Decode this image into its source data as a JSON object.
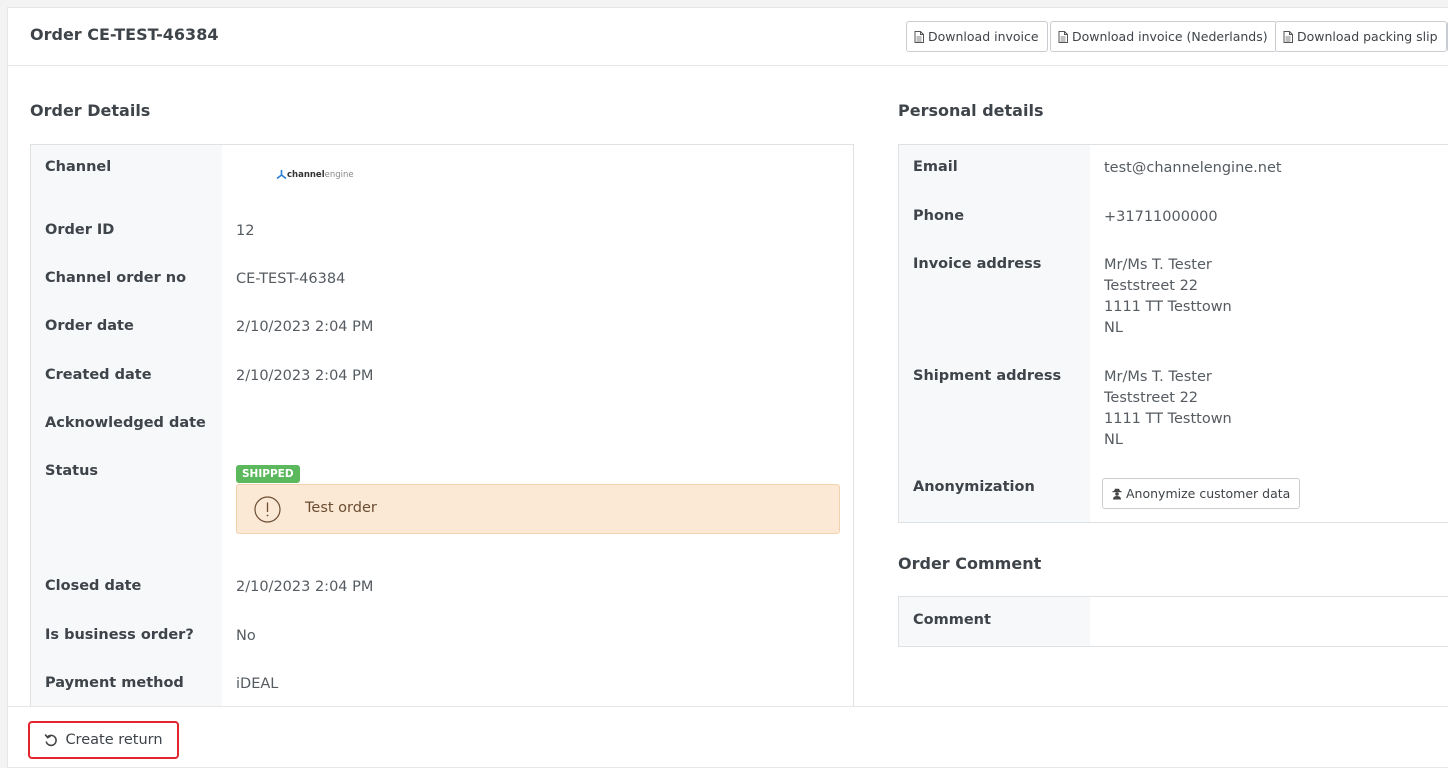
{
  "header": {
    "title": "Order CE-TEST-46384",
    "buttons": {
      "download_invoice": "Download invoice",
      "download_invoice_nl": "Download invoice (Nederlands)",
      "download_packing_slip": "Download packing slip"
    }
  },
  "order_details": {
    "title": "Order Details",
    "channel_logo": {
      "bold": "channel",
      "light": "engine"
    },
    "rows": [
      {
        "label": "Channel",
        "value": ""
      },
      {
        "label": "Order ID",
        "value": "12"
      },
      {
        "label": "Channel order no",
        "value": "CE-TEST-46384"
      },
      {
        "label": "Order date",
        "value": "2/10/2023 2:04 PM"
      },
      {
        "label": "Created date",
        "value": "2/10/2023 2:04 PM"
      },
      {
        "label": "Acknowledged date",
        "value": ""
      },
      {
        "label": "Status",
        "value": ""
      },
      {
        "label": "Closed date",
        "value": "2/10/2023 2:04 PM"
      },
      {
        "label": "Is business order?",
        "value": "No"
      },
      {
        "label": "Payment method",
        "value": "iDEAL"
      }
    ],
    "status_badge": "SHIPPED",
    "alert_text": "Test order",
    "colors": {
      "badge": "#5cb85c",
      "alert_bg": "#fbe8d5"
    }
  },
  "personal_details": {
    "title": "Personal details",
    "email_label": "Email",
    "email": "test@channelengine.net",
    "phone_label": "Phone",
    "phone": "+31711000000",
    "invoice_label": "Invoice address",
    "invoice_address": [
      "Mr/Ms T. Tester",
      "Teststreet 22",
      "1111 TT Testtown",
      "NL"
    ],
    "shipment_label": "Shipment address",
    "shipment_address": [
      "Mr/Ms T. Tester",
      "Teststreet 22",
      "1111 TT Testtown",
      "NL"
    ],
    "anonymization_label": "Anonymization",
    "anonymize_button": "Anonymize customer data"
  },
  "order_comment": {
    "title": "Order Comment",
    "comment_label": "Comment",
    "comment_value": ""
  },
  "footer": {
    "create_return": "Create return",
    "highlight_color": "#e3262d"
  }
}
